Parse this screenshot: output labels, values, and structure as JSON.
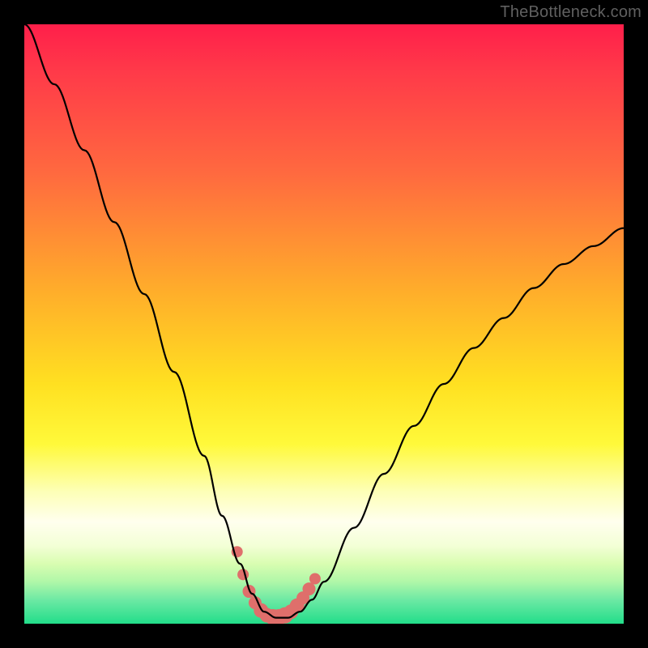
{
  "watermark": "TheBottleneck.com",
  "colors": {
    "page_bg": "#000000",
    "curve": "#000000",
    "marker": "#df6f6b"
  },
  "chart_data": {
    "type": "line",
    "title": "",
    "xlabel": "",
    "ylabel": "",
    "xlim": [
      0,
      100
    ],
    "ylim": [
      0,
      100
    ],
    "grid": false,
    "legend": false,
    "series": [
      {
        "name": "bottleneck-curve",
        "x": [
          0,
          5,
          10,
          15,
          20,
          25,
          30,
          33,
          36,
          38,
          40,
          42,
          44,
          46,
          48,
          50,
          55,
          60,
          65,
          70,
          75,
          80,
          85,
          90,
          95,
          100
        ],
        "y": [
          100,
          90,
          79,
          67,
          55,
          42,
          28,
          18,
          10,
          5,
          2,
          1,
          1,
          2,
          4,
          7,
          16,
          25,
          33,
          40,
          46,
          51,
          56,
          60,
          63,
          66
        ]
      }
    ],
    "markers": {
      "name": "valley-highlight",
      "x": [
        35.5,
        36.5,
        37.5,
        38.5,
        39.5,
        40.5,
        41.5,
        42.5,
        43.5,
        44.5,
        45.5,
        46.5,
        47.5,
        48.5
      ],
      "y": [
        12,
        8.2,
        5.4,
        3.5,
        2.2,
        1.4,
        1.1,
        1.1,
        1.4,
        2.0,
        3.0,
        4.3,
        5.8,
        7.5
      ],
      "r": [
        7,
        7,
        8,
        8,
        9,
        9,
        10,
        10,
        10,
        9,
        9,
        8,
        8,
        7
      ]
    }
  }
}
